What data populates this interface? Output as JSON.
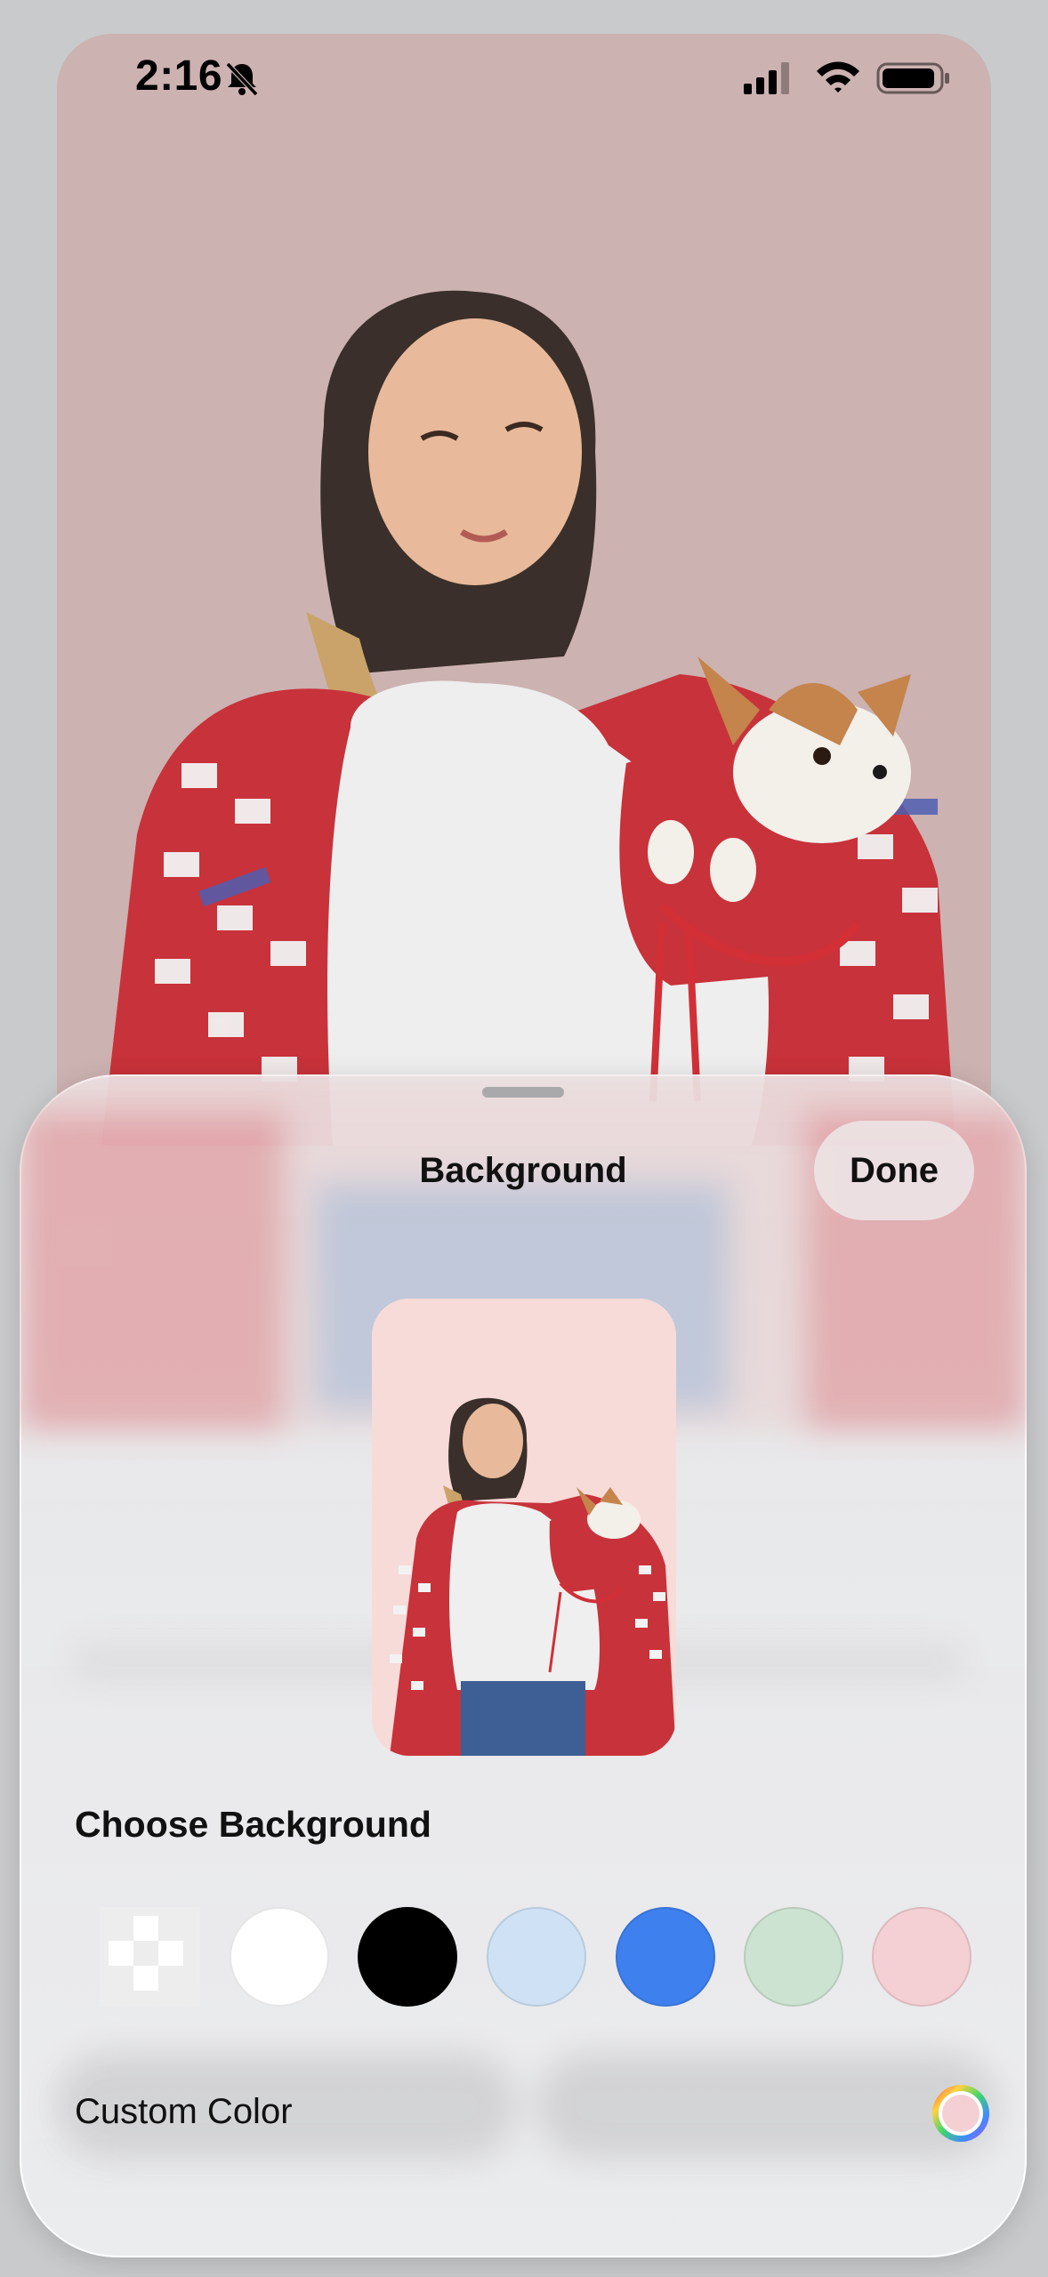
{
  "status_bar": {
    "time": "2:16",
    "icons": [
      "bell-slash-icon",
      "cellular-signal-icon",
      "wifi-icon",
      "battery-icon"
    ]
  },
  "sheet": {
    "title": "Background",
    "done_label": "Done",
    "choose_heading": "Choose Background",
    "swatches": [
      {
        "name": "transparent",
        "color": "checkerboard"
      },
      {
        "name": "white",
        "color": "#FFFFFF"
      },
      {
        "name": "black",
        "color": "#000000"
      },
      {
        "name": "light-blue",
        "color": "#CFE2F5"
      },
      {
        "name": "blue",
        "color": "#3E80EE"
      },
      {
        "name": "light-green",
        "color": "#CDE3D1"
      },
      {
        "name": "pink",
        "color": "#F4D0D4"
      }
    ],
    "custom_color_label": "Custom Color",
    "custom_color_icon": "color-wheel-icon"
  },
  "colors": {
    "canvas_background": "#CCB2B1",
    "preview_background": "#F7DBD8"
  }
}
